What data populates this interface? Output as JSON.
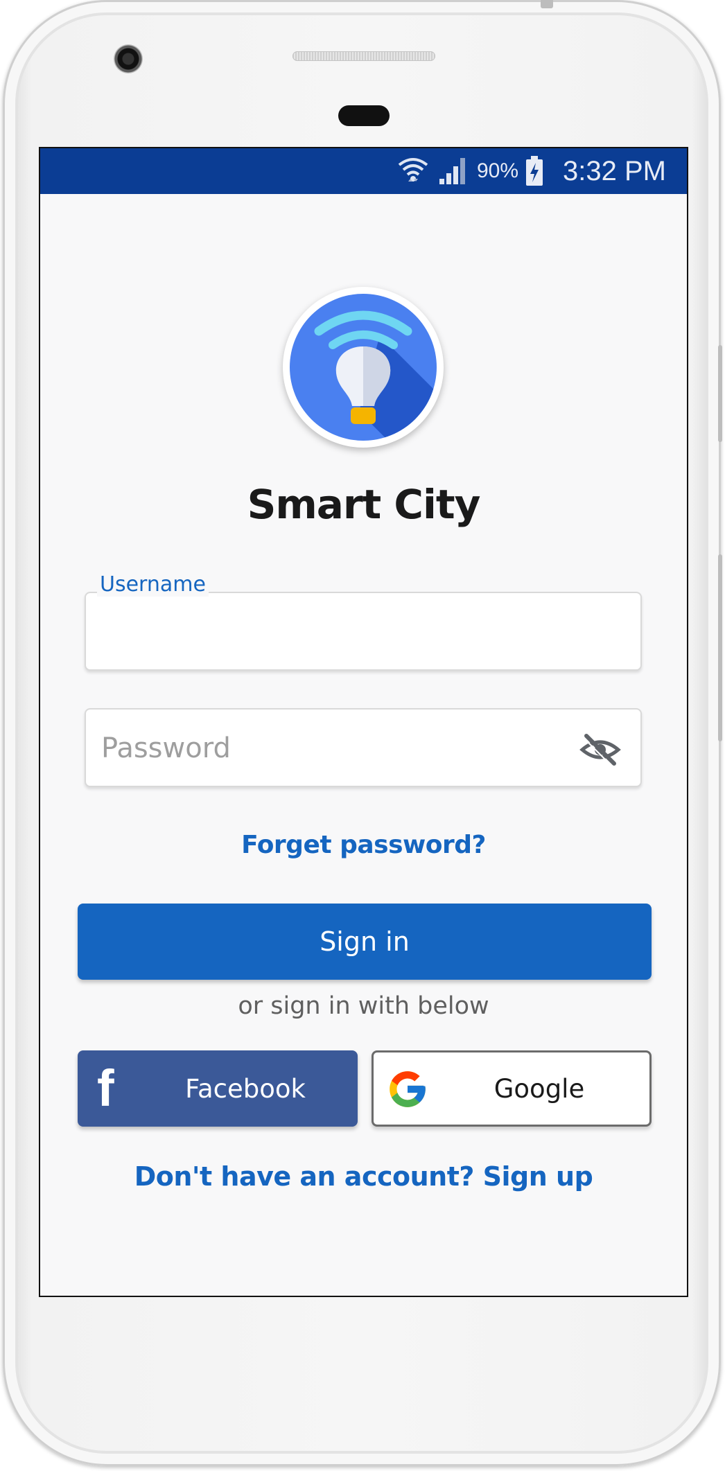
{
  "status_bar": {
    "battery_percent": "90%",
    "time": "3:32 PM"
  },
  "app": {
    "title": "Smart City"
  },
  "form": {
    "username_label": "Username",
    "username_value": "",
    "password_placeholder": "Password",
    "password_value": ""
  },
  "links": {
    "forget_password": "Forget password?",
    "signup": "Don't have an account? Sign up"
  },
  "buttons": {
    "sign_in": "Sign in",
    "alt_text": "or sign in with below",
    "facebook": "Facebook",
    "google": "Google"
  },
  "colors": {
    "status_bar": "#0b3d94",
    "primary": "#1565c0",
    "facebook": "#3b5998"
  }
}
